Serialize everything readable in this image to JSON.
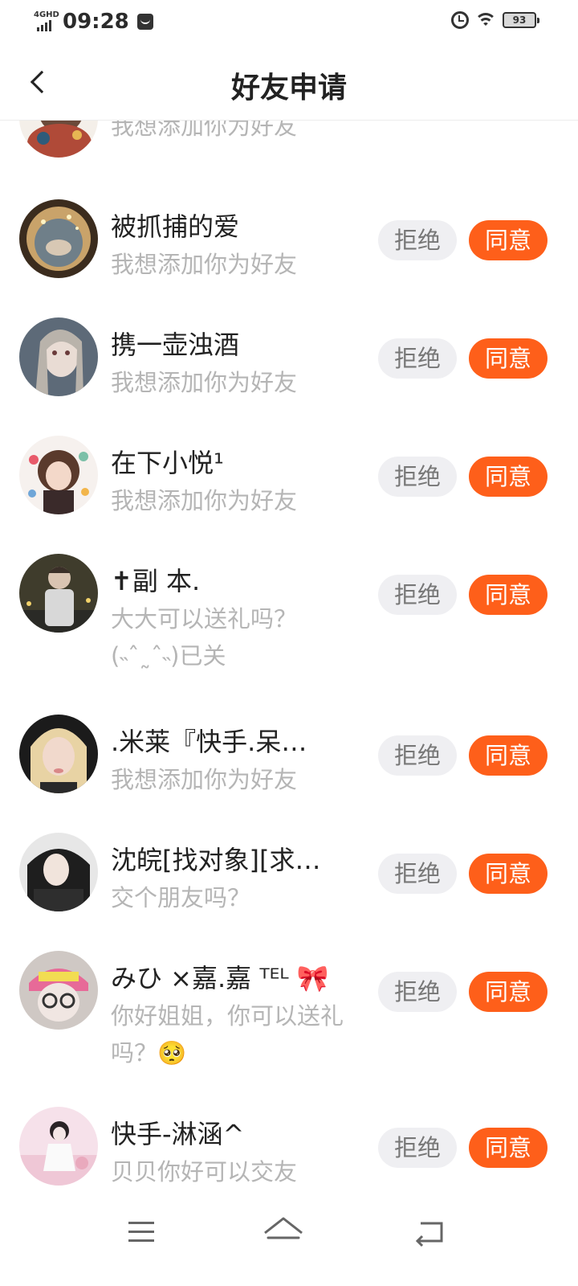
{
  "status_bar": {
    "network": "4GHD",
    "time": "09:28",
    "battery": "93"
  },
  "header": {
    "title": "好友申请"
  },
  "buttons": {
    "reject": "拒绝",
    "accept": "同意"
  },
  "requests": [
    {
      "name": "",
      "message": "我想添加你为好友",
      "avatar": "partial-avatar"
    },
    {
      "name": "被抓捕的爱",
      "message": "我想添加你为好友",
      "avatar": "night-sky-avatar"
    },
    {
      "name": "携一壶浊酒",
      "message": "我想添加你为好友",
      "avatar": "illustrated-girl-avatar"
    },
    {
      "name": "在下小悦¹",
      "message": "我想添加你为好友",
      "avatar": "anime-girl-avatar"
    },
    {
      "name": "✝副 本.",
      "message": "大大可以送礼吗？(˵ˆ˷ˆ˵)已关",
      "avatar": "boy-street-avatar"
    },
    {
      "name": ".米莱『快手.呆…",
      "message": "我想添加你为好友",
      "avatar": "blonde-girl-avatar"
    },
    {
      "name": "沈皖[找对象][求…",
      "message": "交个朋友吗？",
      "avatar": "dark-hair-girl-avatar"
    },
    {
      "name": "みひ ×嘉.嘉 ᵀᴱᴸ 🎀",
      "message": "你好姐姐，你可以送礼吗？🥺",
      "avatar": "pink-cap-avatar"
    },
    {
      "name": "快手-淋涵^",
      "message": "贝贝你好可以交友",
      "avatar": "pink-room-avatar"
    }
  ],
  "colors": {
    "accent": "#fe5f1a",
    "reject_bg": "#efeff2",
    "secondary_text": "#b5b5b5"
  }
}
